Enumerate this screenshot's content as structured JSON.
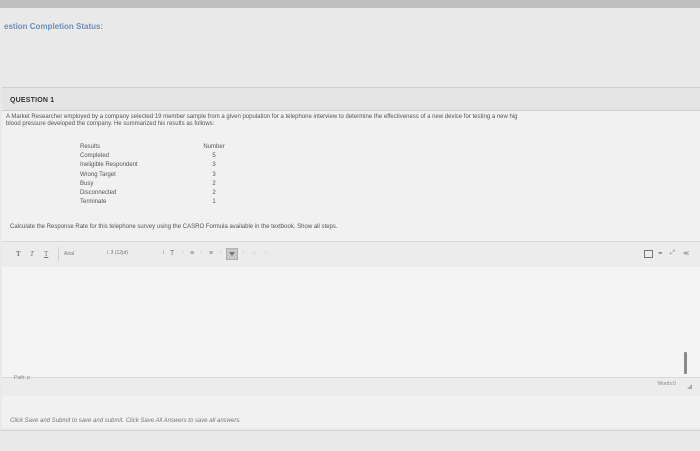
{
  "top_status": "estion Completion Status:",
  "question": {
    "title": "QUESTION 1",
    "text_line1": "A Market Researcher employed by a company selected 19 member sample from a given population for a telephone interview to determine the effectiveness of a new device for testing a new hig",
    "text_line2": "blood pressure developed the company. He summarized his results as follows:",
    "table": {
      "header": {
        "label": "Results",
        "value": "Number"
      },
      "rows": [
        {
          "label": "Completed",
          "value": "5"
        },
        {
          "label": "Ineligible Respondent",
          "value": "3"
        },
        {
          "label": "Wrong  Target",
          "value": "3"
        },
        {
          "label": "Busy",
          "value": "2"
        },
        {
          "label": "Disconnected",
          "value": "2"
        },
        {
          "label": "Terminate",
          "value": "1"
        }
      ]
    },
    "instruction": "Calculate the Response Rate for this telephone survey using the CASRO Formula available in the textbook. Show all steps."
  },
  "toolbar": {
    "bold": "T",
    "italic": "T",
    "underline": "T",
    "font_family": "Arial",
    "font_size": "3 (12pt)",
    "text_color": "T"
  },
  "editor": {
    "path_label": "Path: p",
    "words_label": "Words:0"
  },
  "footer_note": "Click Save and Submit to save and submit. Click Save All Answers to save all answers."
}
